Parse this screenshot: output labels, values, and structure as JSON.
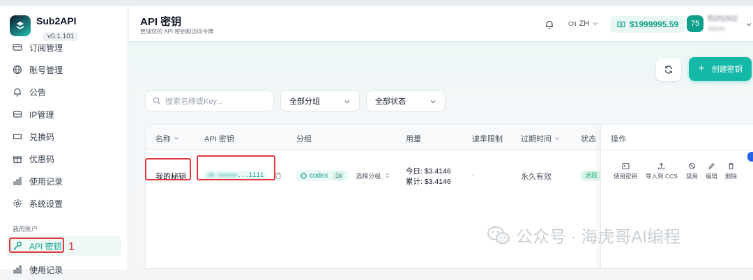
{
  "brand": {
    "name": "Sub2API",
    "version": "v0.1.101"
  },
  "sidebar": {
    "items": [
      {
        "label": "订阅管理",
        "icon": "card-icon"
      },
      {
        "label": "账号管理",
        "icon": "globe-icon"
      },
      {
        "label": "公告",
        "icon": "bell-icon"
      },
      {
        "label": "IP管理",
        "icon": "server-icon"
      },
      {
        "label": "兑换码",
        "icon": "ticket-icon"
      },
      {
        "label": "优惠码",
        "icon": "gift-icon"
      },
      {
        "label": "使用记录",
        "icon": "bar-chart-icon"
      },
      {
        "label": "系统设置",
        "icon": "gear-icon"
      }
    ],
    "section_label": "我的账户",
    "account_items": [
      {
        "label": "API 密钥",
        "icon": "key-icon",
        "active": true
      },
      {
        "label": "使用记录",
        "icon": "bar-chart-icon"
      }
    ],
    "annotation_number": "1"
  },
  "header": {
    "title": "API 密钥",
    "subtitle": "管理您的 API 密钥和访问令牌",
    "lang_code": "CN",
    "lang": "ZH",
    "balance": "$1999995.59",
    "avatar_text": "75",
    "user_name": "f52f1002",
    "user_role": "Admin"
  },
  "toolbar": {
    "create_label": "创建密钥",
    "search_placeholder": "搜索名称或Key...",
    "group_filter": "全部分组",
    "status_filter": "全部状态"
  },
  "table": {
    "columns": [
      "名称",
      "API 密钥",
      "分组",
      "用量",
      "速率限制",
      "过期时间",
      "状态",
      "操作"
    ],
    "rows": [
      {
        "name": "我的秘钥",
        "key_prefix": "sk-xxxxx",
        "key_suffix": "...1111",
        "group": "codex",
        "group_multiplier": "1x",
        "select_group": "选择分组",
        "usage_today": "今日: $3.4146",
        "usage_total": "累计: $3.4146",
        "rate_limit": "-",
        "expires": "永久有效",
        "status": "活跃"
      }
    ],
    "actions": [
      "使用密钥",
      "导入到 CCS",
      "禁用",
      "编辑",
      "删除"
    ]
  },
  "watermark": {
    "text": "公众号 · 海虎哥AI编程"
  },
  "colors": {
    "accent": "#14b8a6",
    "annotation": "#e0393e"
  }
}
